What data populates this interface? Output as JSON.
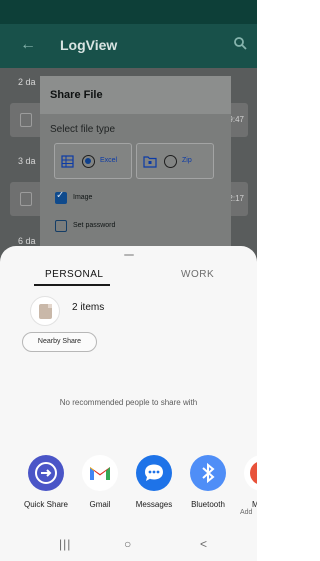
{
  "app": {
    "title": "LogView",
    "back_icon": "back-arrow-icon",
    "search_icon": "search-icon",
    "status_bar_color": "#0d3f38"
  },
  "log_list": {
    "groups": [
      {
        "header": "2 da",
        "time": "9:47"
      },
      {
        "header": "3 da",
        "time": "2:17"
      },
      {
        "header": "6 da",
        "time": ""
      }
    ]
  },
  "dialog": {
    "title": "Share File",
    "subtitle": "Select file type",
    "options": [
      {
        "label": "Excel",
        "selected": true,
        "icon": "excel-file-icon"
      },
      {
        "label": "Zip",
        "selected": false,
        "icon": "zip-folder-icon"
      }
    ],
    "checkboxes": [
      {
        "label": "Image",
        "checked": true
      },
      {
        "label": "Set password",
        "checked": false
      }
    ]
  },
  "share_sheet": {
    "tabs": [
      "PERSONAL",
      "WORK"
    ],
    "active_tab": "PERSONAL",
    "items_text": "2 items",
    "nearby_share_label": "Nearby Share",
    "no_recommendations": "No recommended people to share with",
    "apps": [
      {
        "label": "Quick Share",
        "icon": "quick-share-icon",
        "color": "#4a55c7"
      },
      {
        "label": "Gmail",
        "icon": "gmail-icon",
        "color": "#ffffff"
      },
      {
        "label": "Messages",
        "icon": "messages-icon",
        "color": "#1e73e8"
      },
      {
        "label": "Bluetooth",
        "icon": "bluetooth-icon",
        "color": "#4f8ef7"
      },
      {
        "label": "M",
        "sub_label": "Add",
        "icon": "partial-app-icon",
        "color": "#e8523a"
      }
    ]
  },
  "navbar": {
    "recents": "|||",
    "home": "○",
    "back": "<"
  }
}
